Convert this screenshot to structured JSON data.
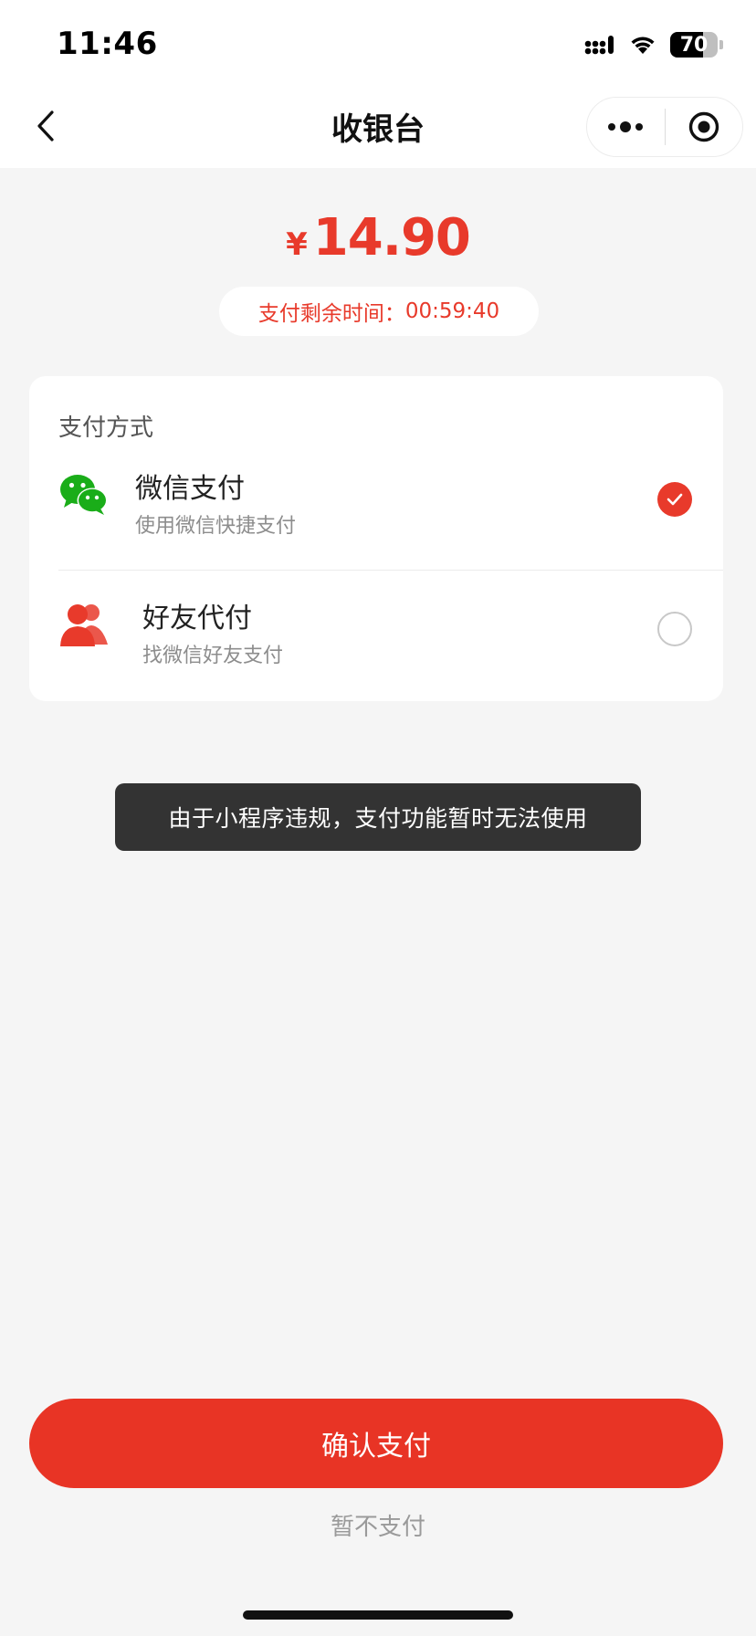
{
  "status_bar": {
    "time": "11:46",
    "battery_level": "70",
    "battery_fraction": 0.7,
    "icons": [
      "cellular-signal-icon",
      "wifi-icon",
      "battery-icon"
    ]
  },
  "nav": {
    "title": "收银台",
    "icons": [
      "chevron-left-icon",
      "more-dots-icon",
      "record-target-icon"
    ]
  },
  "payment": {
    "currency_symbol": "¥",
    "amount": "14.90",
    "timer_label": "支付剩余时间：",
    "timer_value": "00:59:40"
  },
  "methods": {
    "section_title": "支付方式",
    "items": [
      {
        "label": "微信支付",
        "sub": "使用微信快捷支付",
        "icon": "wechat-icon",
        "selected": true
      },
      {
        "label": "好友代付",
        "sub": "找微信好友支付",
        "icon": "friends-icon",
        "selected": false
      }
    ]
  },
  "toast": {
    "message": "由于小程序违规，支付功能暂时无法使用"
  },
  "actions": {
    "confirm_label": "确认支付",
    "skip_label": "暂不支付"
  },
  "colors": {
    "accent": "#e83a2b",
    "wechat_green": "#1aad19",
    "toast_bg": "#333333",
    "background": "#f5f5f5"
  }
}
